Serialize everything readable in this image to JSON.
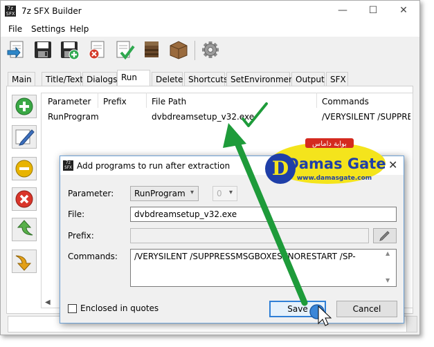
{
  "window": {
    "title": "7z SFX Builder",
    "app_icon_text": "7z SFX",
    "controls": {
      "minimize": "—",
      "maximize": "☐",
      "close": "✕"
    }
  },
  "menu": [
    "File",
    "Settings",
    "Help"
  ],
  "toolbar": {
    "icons": [
      "open-config-icon",
      "save-icon",
      "save-as-icon",
      "clear-icon",
      "check-icon",
      "archive-icon",
      "box-icon",
      "gear-icon"
    ]
  },
  "tabs": [
    "Main",
    "Title/Text",
    "Dialogs",
    "Run",
    "Delete",
    "Shortcuts",
    "SetEnvironment",
    "Output",
    "SFX"
  ],
  "active_tab": "Run",
  "side_buttons": [
    "add-icon",
    "edit-icon",
    "remove-icon",
    "delete-icon",
    "move-up-icon",
    "move-down-icon"
  ],
  "table": {
    "columns": [
      "Parameter",
      "Prefix",
      "File Path",
      "Commands"
    ],
    "rows": [
      {
        "parameter": "RunProgram",
        "prefix": "",
        "file_path": "dvbdreamsetup_v32.exe",
        "commands": "/VERYSILENT /SUPPRESS..."
      }
    ]
  },
  "dialog": {
    "title": "Add programs to run after extraction",
    "icon_text": "7z SFX",
    "close_glyph": "✕",
    "parameter_label": "Parameter:",
    "parameter_value": "RunProgram",
    "parameter_index": "0",
    "file_label": "File:",
    "file_value": "dvbdreamsetup_v32.exe",
    "prefix_label": "Prefix:",
    "prefix_value": "",
    "commands_label": "Commands:",
    "commands_value": "/VERYSILENT /SUPPRESSMSGBOXES /NORESTART /SP-",
    "enclosed_label": "Enclosed in quotes",
    "enclosed_checked": false,
    "save_label": "Save",
    "cancel_label": "Cancel"
  },
  "watermark": {
    "arabic": "بوابة داماس",
    "name": "Damas Gate",
    "url": "www.damasgate.com"
  },
  "colors": {
    "annotation_green": "#1e9b3a",
    "watermark_yellow": "#f4e41c",
    "watermark_blue": "#1f3fa8",
    "watermark_red": "#d42a1f",
    "dialog_border": "#6a9fd4"
  }
}
